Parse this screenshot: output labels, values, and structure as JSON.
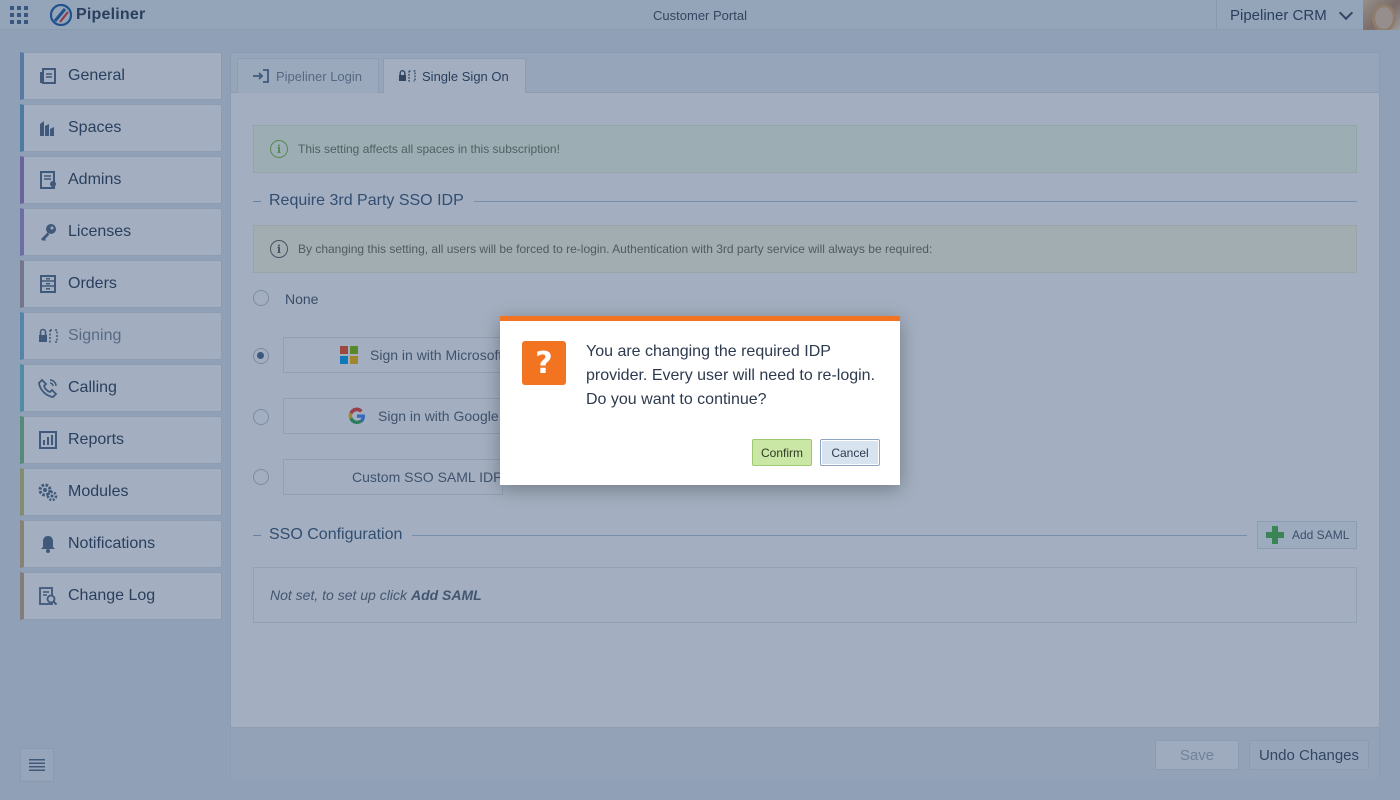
{
  "topbar": {
    "apps_icon": "apps-grid-icon",
    "logo_text": "Pipeliner",
    "portal_title": "Customer Portal",
    "crm_switch_label": "Pipeliner CRM",
    "brand_color": "#1f5fa8"
  },
  "sidebar": {
    "items": [
      {
        "label": "General",
        "icon": "general-icon",
        "color": "#7fa3c8"
      },
      {
        "label": "Spaces",
        "icon": "spaces-icon",
        "color": "#6ba7c8"
      },
      {
        "label": "Admins",
        "icon": "admins-icon",
        "color": "#9b7dbd"
      },
      {
        "label": "Licenses",
        "icon": "key-icon",
        "color": "#a08fd0"
      },
      {
        "label": "Orders",
        "icon": "orders-icon",
        "color": "#b09aa8"
      },
      {
        "label": "Signing",
        "icon": "signing-icon",
        "color": "#79b8d8",
        "active": true
      },
      {
        "label": "Calling",
        "icon": "phone-icon",
        "color": "#74c1d2"
      },
      {
        "label": "Reports",
        "icon": "reports-icon",
        "color": "#7bbf86"
      },
      {
        "label": "Modules",
        "icon": "gears-icon",
        "color": "#c9c37a"
      },
      {
        "label": "Notifications",
        "icon": "bell-icon",
        "color": "#d3b07a"
      },
      {
        "label": "Change Log",
        "icon": "change-log-icon",
        "color": "#caa885"
      }
    ]
  },
  "tabs": [
    {
      "label": "Pipeliner Login",
      "icon": "login-icon"
    },
    {
      "label": "Single Sign On",
      "icon": "sso-icon",
      "active": true
    }
  ],
  "notice_global": "This setting affects all spaces in this subscription!",
  "require_idp": {
    "title": "Require 3rd Party SSO IDP",
    "notice": "By changing this setting, all users will be forced to re-login. Authentication with 3rd party service will always be required:",
    "options": {
      "none": "None",
      "microsoft": "Sign in with Microsoft",
      "google": "Sign in with Google",
      "custom": "Custom SSO SAML IDP"
    }
  },
  "sso_config": {
    "title": "SSO Configuration",
    "add_button": "Add SAML",
    "empty_prefix": "Not set, to set up click",
    "empty_link": "Add SAML"
  },
  "footer": {
    "save": "Save",
    "undo": "Undo Changes"
  },
  "dialog": {
    "icon": "question-icon",
    "message": "You are changing the required IDP provider. Every user will need to re-login. Do you want to continue?",
    "confirm": "Confirm",
    "cancel": "Cancel",
    "accent_color": "#f27420"
  }
}
